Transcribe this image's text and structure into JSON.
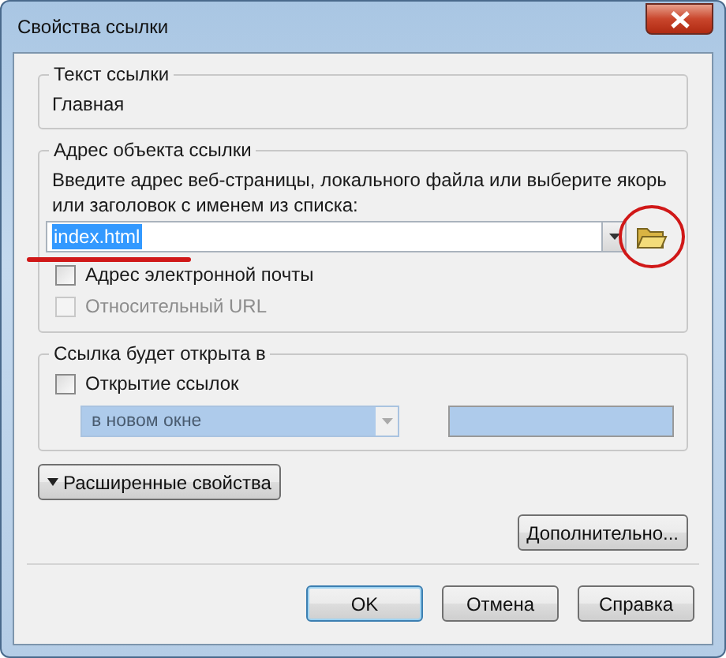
{
  "window": {
    "title": "Свойства ссылки"
  },
  "link_text": {
    "legend": "Текст ссылки",
    "value": "Главная"
  },
  "link_target": {
    "legend": "Адрес объекта ссылки",
    "hint": "Введите адрес веб-страницы, локального файла или выберите якорь или заголовок с именем из списка:",
    "value": "index.html",
    "value_selected": true,
    "checkboxes": [
      {
        "label": "Адрес электронной почты",
        "checked": false,
        "disabled": false
      },
      {
        "label": "Относительный URL",
        "checked": false,
        "disabled": true
      }
    ]
  },
  "open_in": {
    "legend": "Ссылка будет открыта в",
    "checkbox": {
      "label": "Открытие ссылок",
      "checked": false,
      "disabled": false
    },
    "dropdown": {
      "value": "в новом окне",
      "disabled": true
    },
    "frame_field": {
      "disabled": true
    }
  },
  "advanced_toggle": {
    "label": "Расширенные свойства",
    "expanded": false
  },
  "more_button": "Дополнительно...",
  "buttons": [
    {
      "label": "OK",
      "default": true
    },
    {
      "label": "Отмена",
      "default": false
    },
    {
      "label": "Справка",
      "default": false
    }
  ],
  "annotation_underline": {
    "color": "#d01818"
  },
  "annotation_circle": {
    "color": "#d01818"
  }
}
